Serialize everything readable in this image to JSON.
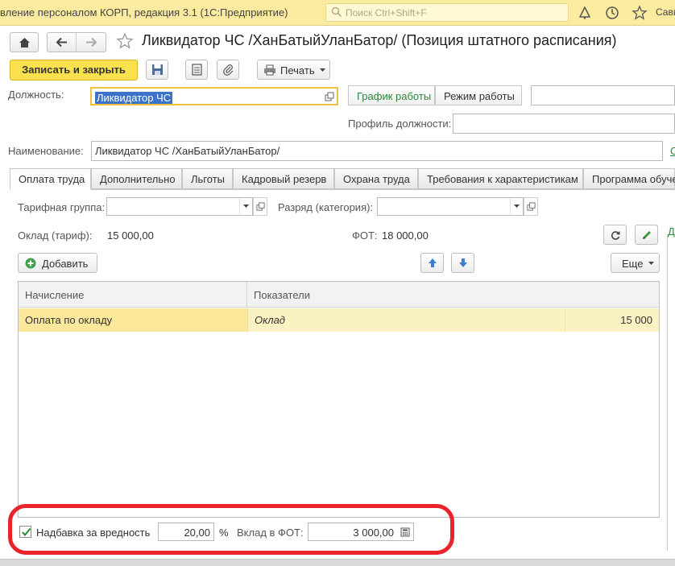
{
  "window": {
    "app_title": "вление персоналом КОРП, редакция 3.1  (1С:Предприятие)",
    "search_placeholder": "Поиск Ctrl+Shift+F",
    "user_name": "Сави"
  },
  "header": {
    "doc_title": "Ликвидатор ЧС /ХанБатыйУланБатор/ (Позиция штатного расписания)"
  },
  "toolbar": {
    "save_close_label": "Записать и закрыть",
    "print_label": "Печать"
  },
  "form": {
    "position_label": "Должность:",
    "position_value": "Ликвидатор ЧС",
    "schedule_link": "График работы",
    "work_mode_label": "Режим работы",
    "profile_label": "Профиль должности:",
    "profile_value": "",
    "name_label": "Наименование:",
    "name_value": "Ликвидатор ЧС /ХанБатыйУланБатор/",
    "name_link_cut": "С"
  },
  "tabs": [
    {
      "label": "Оплата труда"
    },
    {
      "label": "Дополнительно"
    },
    {
      "label": "Льготы"
    },
    {
      "label": "Кадровый резерв"
    },
    {
      "label": "Охрана труда"
    },
    {
      "label": "Требования к характеристикам"
    },
    {
      "label": "Программа обучен"
    }
  ],
  "pay": {
    "tariff_group_label": "Тарифная группа:",
    "tariff_group_value": "",
    "grade_label": "Разряд (категория):",
    "grade_value": "",
    "salary_label": "Оклад (тариф):",
    "salary_value": "15 000,00",
    "fot_label": "ФОТ:",
    "fot_value": "18 000,00",
    "add_label": "Добавить",
    "more_label": "Еще",
    "right_cut_label": "Д"
  },
  "grid": {
    "columns": [
      "Начисление",
      "Показатели"
    ],
    "rows": [
      {
        "accrual": "Оплата по окладу",
        "indicator": "Оклад",
        "value": "15 000"
      }
    ]
  },
  "bottom": {
    "hazard_checked": true,
    "hazard_label": "Надбавка за вредность",
    "hazard_value": "20,00",
    "percent_sign": "%",
    "contribution_label": "Вклад в ФОТ:",
    "contribution_value": "3 000,00"
  },
  "colors": {
    "title_bar": "#fbeba0",
    "primary_button": "#fbe14d",
    "selected_row": "#fbf2c3",
    "link_green": "#2a8a3a",
    "highlight_red": "#e8232a"
  }
}
